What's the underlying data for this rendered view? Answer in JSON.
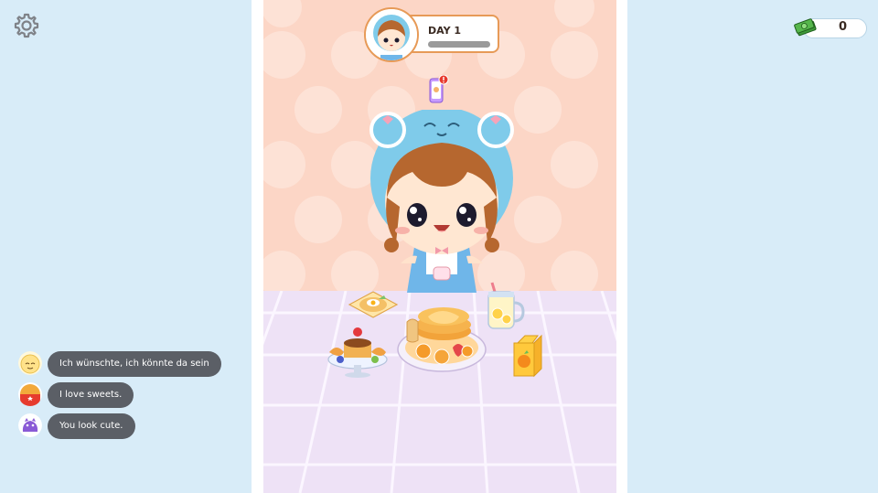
{
  "hud": {
    "day_label": "DAY 1",
    "money_value": "0",
    "day_progress": 0
  },
  "icons": {
    "settings": "gear-icon",
    "money": "cash-icon",
    "phone": "phone-notification-icon"
  },
  "chat": [
    {
      "text": "Ich wünschte, ich könnte da sein",
      "avatar": "yellow-face"
    },
    {
      "text": "I love sweets.",
      "avatar": "red-face"
    },
    {
      "text": "You look cute.",
      "avatar": "purple-monster"
    }
  ],
  "colors": {
    "background": "#d8ecf8",
    "wall": "#fcd6c6",
    "floor": "#eee2f6",
    "accent": "#e79a57",
    "chat_bubble": "#5b5f66"
  }
}
